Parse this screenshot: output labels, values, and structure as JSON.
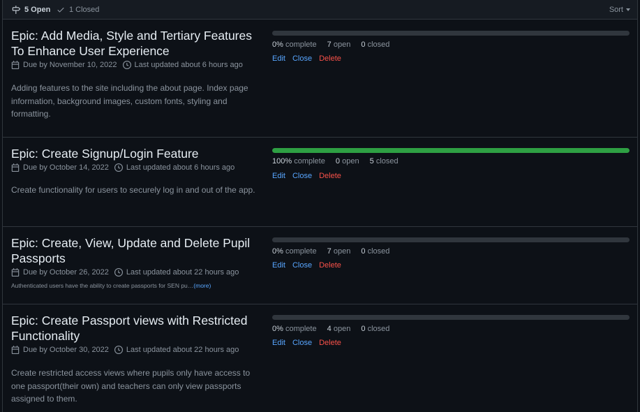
{
  "header": {
    "open_label": "5 Open",
    "closed_label": "1 Closed",
    "sort_label": "Sort"
  },
  "milestones": [
    {
      "title": "Epic: Add Media, Style and Tertiary Features To Enhance User Experience",
      "due": "Due by November 10, 2022",
      "updated": "Last updated about 6 hours ago",
      "description": "Adding features to the site including the about page. Index page information, background images, custom fonts, styling and formatting.",
      "progress": 0,
      "complete_pct": "0%",
      "complete_label": "complete",
      "open_count": "7",
      "open_label": "open",
      "closed_count": "0",
      "closed_label": "closed",
      "edit_label": "Edit",
      "close_label": "Close",
      "delete_label": "Delete"
    },
    {
      "title": "Epic: Create Signup/Login Feature",
      "due": "Due by October 14, 2022",
      "updated": "Last updated about 6 hours ago",
      "description": "Create functionality for users to securely log in and out of the app.",
      "progress": 100,
      "complete_pct": "100%",
      "complete_label": "complete",
      "open_count": "0",
      "open_label": "open",
      "closed_count": "5",
      "closed_label": "closed",
      "edit_label": "Edit",
      "close_label": "Close",
      "delete_label": "Delete"
    },
    {
      "title": "Epic: Create, View, Update and Delete Pupil Passports",
      "due": "Due by October 26, 2022",
      "updated": "Last updated about 22 hours ago",
      "description": "Authenticated users have the ability to create passports for SEN pu…",
      "more_label": "(more)",
      "progress": 0,
      "complete_pct": "0%",
      "complete_label": "complete",
      "open_count": "7",
      "open_label": "open",
      "closed_count": "0",
      "closed_label": "closed",
      "edit_label": "Edit",
      "close_label": "Close",
      "delete_label": "Delete"
    },
    {
      "title": "Epic: Create Passport views with Restricted Functionality",
      "due": "Due by October 30, 2022",
      "updated": "Last updated about 22 hours ago",
      "description": "Create restricted access views where pupils only have access to one passport(their own) and teachers can only view passports assigned to them.",
      "progress": 0,
      "complete_pct": "0%",
      "complete_label": "complete",
      "open_count": "4",
      "open_label": "open",
      "closed_count": "0",
      "closed_label": "closed",
      "edit_label": "Edit",
      "close_label": "Close",
      "delete_label": "Delete"
    }
  ],
  "icons": {
    "milestone": "milestone-icon",
    "check": "check-icon",
    "calendar": "calendar-icon",
    "clock": "clock-icon"
  },
  "colors": {
    "progress_fill": "#2ea043",
    "link": "#58a6ff",
    "danger": "#f85149"
  }
}
